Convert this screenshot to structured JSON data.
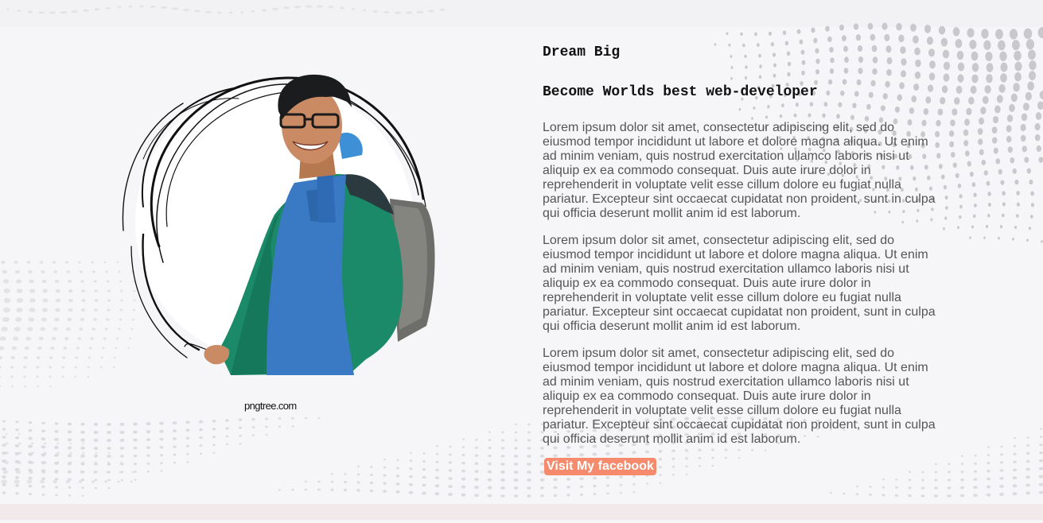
{
  "hero": {
    "title": "Dream Big",
    "subtitle": "Become Worlds best web-developer",
    "paragraphs": [
      "Lorem ipsum dolor sit amet, consectetur adipiscing elit, sed do eiusmod tempor incididunt ut labore et dolore magna aliqua. Ut enim ad minim veniam, quis nostrud exercitation ullamco laboris nisi ut aliquip ex ea commodo consequat. Duis aute irure dolor in reprehenderit in voluptate velit esse cillum dolore eu fugiat nulla pariatur. Excepteur sint occaecat cupidatat non proident, sunt in culpa qui officia deserunt mollit anim id est laborum.",
      "Lorem ipsum dolor sit amet, consectetur adipiscing elit, sed do eiusmod tempor incididunt ut labore et dolore magna aliqua. Ut enim ad minim veniam, quis nostrud exercitation ullamco laboris nisi ut aliquip ex ea commodo consequat. Duis aute irure dolor in reprehenderit in voluptate velit esse cillum dolore eu fugiat nulla pariatur. Excepteur sint occaecat cupidatat non proident, sunt in culpa qui officia deserunt mollit anim id est laborum.",
      "Lorem ipsum dolor sit amet, consectetur adipiscing elit, sed do eiusmod tempor incididunt ut labore et dolore magna aliqua. Ut enim ad minim veniam, quis nostrud exercitation ullamco laboris nisi ut aliquip ex ea commodo consequat. Duis aute irure dolor in reprehenderit in voluptate velit esse cillum dolore eu fugiat nulla pariatur. Excepteur sint occaecat cupidatat non proident, sunt in culpa qui officia deserunt mollit anim id est laborum."
    ],
    "button_label": "Visit My facebook"
  },
  "image": {
    "watermark": "pngtree.com"
  },
  "colors": {
    "background": "#f6f6f8",
    "button": "#f58a6c",
    "heading_text": "#111111",
    "body_text": "#555555"
  }
}
